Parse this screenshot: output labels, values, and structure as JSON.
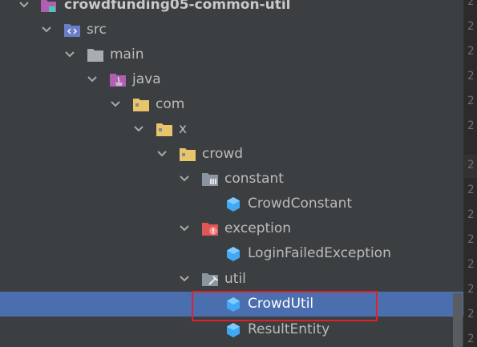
{
  "tree": {
    "items": [
      {
        "label": "crowdfunding05-common-util",
        "icon": "module-folder-icon",
        "expanded": true
      },
      {
        "label": "src",
        "icon": "source-folder-icon",
        "expanded": true
      },
      {
        "label": "main",
        "icon": "folder-icon",
        "expanded": true
      },
      {
        "label": "java",
        "icon": "java-source-root-icon",
        "expanded": true
      },
      {
        "label": "com",
        "icon": "package-icon",
        "expanded": true
      },
      {
        "label": "x",
        "icon": "package-icon",
        "expanded": true
      },
      {
        "label": "crowd",
        "icon": "package-icon",
        "expanded": true
      },
      {
        "label": "constant",
        "icon": "constant-package-icon",
        "expanded": true
      },
      {
        "label": "CrowdConstant",
        "icon": "java-class-icon"
      },
      {
        "label": "exception",
        "icon": "exception-package-icon",
        "expanded": true
      },
      {
        "label": "LoginFailedException",
        "icon": "java-class-icon"
      },
      {
        "label": "util",
        "icon": "util-package-icon",
        "expanded": true
      },
      {
        "label": "CrowdUtil",
        "icon": "java-class-icon",
        "selected": true
      },
      {
        "label": "ResultEntity",
        "icon": "java-class-icon"
      }
    ]
  },
  "gutter": {
    "numbers": [
      "2",
      "2",
      "2",
      "2",
      "2",
      "2",
      "2",
      "2",
      "2",
      "2",
      "2",
      "2",
      "2",
      "2"
    ]
  },
  "colors": {
    "background": "#3c3f41",
    "selection": "#4b6eaf",
    "highlight_box": "#e0212b",
    "folder": "#e8c46b",
    "class_icon": "#3fa9f5"
  }
}
